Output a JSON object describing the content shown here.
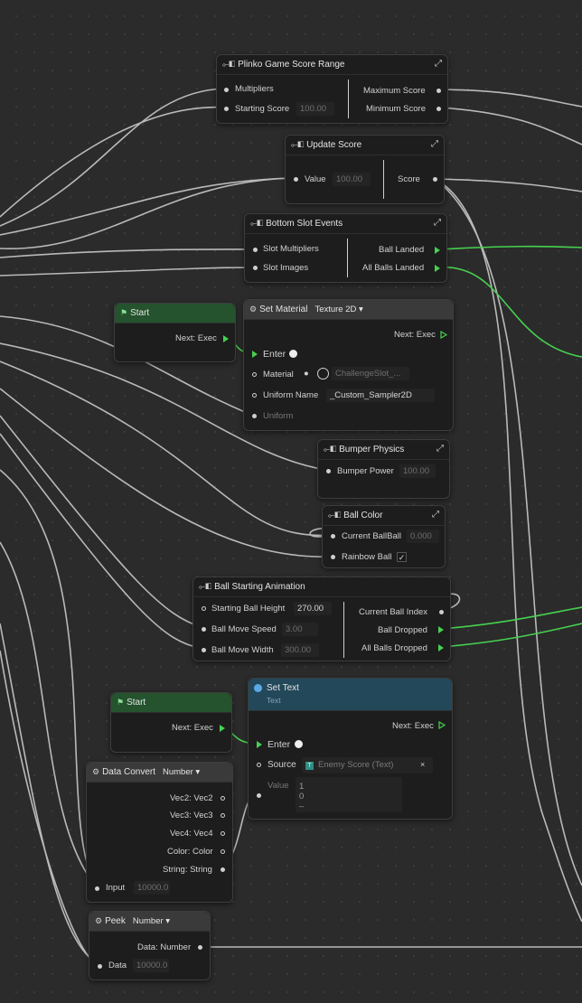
{
  "nodes": {
    "plinko": {
      "title": "Plinko Game Score Range",
      "in1": "Multipliers",
      "in2": "Starting Score",
      "in2_value": "100.00",
      "out1": "Maximum Score",
      "out2": "Minimum Score"
    },
    "update_score": {
      "title": "Update Score",
      "in1": "Value",
      "in1_value": "100.00",
      "out1": "Score"
    },
    "bottom_slot": {
      "title": "Bottom Slot Events",
      "in1": "Slot Multipliers",
      "in2": "Slot Images",
      "out1": "Ball Landed",
      "out2": "All Balls Landed"
    },
    "start1": {
      "title": "Start",
      "out1": "Next: Exec"
    },
    "set_material": {
      "title": "Set Material",
      "type": "Texture 2D",
      "next": "Next: Exec",
      "enter": "Enter",
      "material": "Material",
      "material_value": "ChallengeSlot_...",
      "uniform_name": "Uniform Name",
      "uniform_name_value": "_Custom_Sampler2D",
      "uniform": "Uniform"
    },
    "bumper": {
      "title": "Bumper Physics",
      "in1": "Bumper Power",
      "in1_value": "100.00"
    },
    "ball_color": {
      "title": "Ball Color",
      "in1": "Current BallBall",
      "in1_value": "0.000",
      "in2": "Rainbow Ball",
      "in2_check": "✓"
    },
    "ball_anim": {
      "title": "Ball Starting Animation",
      "in1": "Starting Ball Height",
      "in1_value": "270.00",
      "in2": "Ball Move Speed",
      "in2_value": "3.00",
      "in3": "Ball Move Width",
      "in3_value": "300.00",
      "out1": "Current Ball Index",
      "out2": "Ball Dropped",
      "out3": "All Balls Dropped"
    },
    "start2": {
      "title": "Start",
      "out1": "Next: Exec"
    },
    "set_text": {
      "title": "Set Text",
      "subtitle": "Text",
      "next": "Next: Exec",
      "enter": "Enter",
      "source": "Source",
      "source_value": "Enemy Score (Text)",
      "value": "Value",
      "value_lines": [
        "1",
        "0",
        "–"
      ]
    },
    "data_convert": {
      "title": "Data Convert",
      "type": "Number",
      "out1": "Vec2: Vec2",
      "out2": "Vec3: Vec3",
      "out3": "Vec4: Vec4",
      "out4": "Color: Color",
      "out5": "String: String",
      "in1": "Input",
      "in1_value": "10000.0"
    },
    "peek": {
      "title": "Peek",
      "type": "Number",
      "out1": "Data: Number",
      "in1": "Data",
      "in1_value": "10000.0"
    }
  },
  "colors": {
    "background": "#2b2b2b",
    "node": "#1d1d1d",
    "exec": "#46d14f",
    "green_header": "#24532d",
    "teal_header": "#23485a",
    "wire": "#c8c8c8"
  }
}
